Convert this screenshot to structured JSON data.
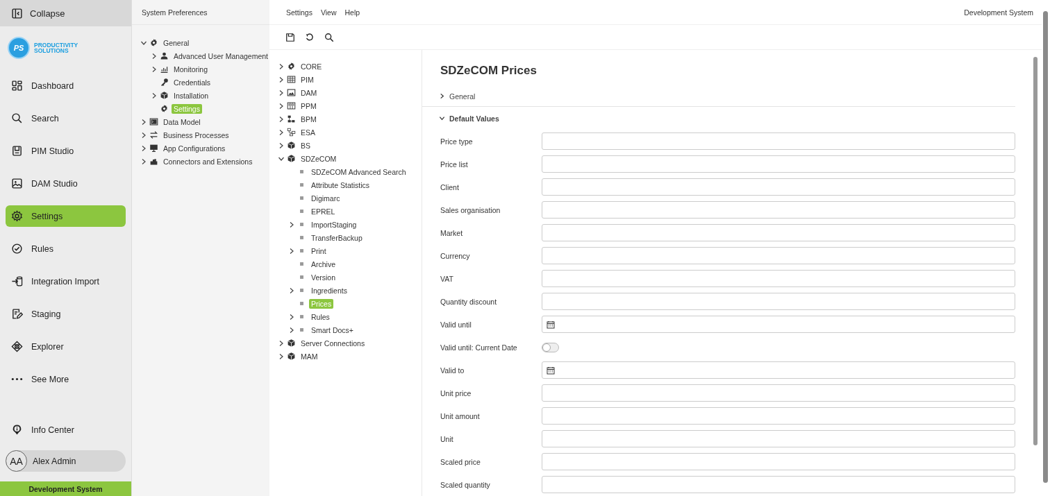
{
  "nav": {
    "collapse": "Collapse",
    "logo": {
      "initials": "PS",
      "line1": "PRODUCTIVITY",
      "line2": "SOLUTIONS"
    },
    "items": [
      {
        "label": "Dashboard",
        "selected": false
      },
      {
        "label": "Search",
        "selected": false
      },
      {
        "label": "PIM Studio",
        "selected": false
      },
      {
        "label": "DAM Studio",
        "selected": false
      },
      {
        "label": "Settings",
        "selected": true
      },
      {
        "label": "Rules",
        "selected": false
      },
      {
        "label": "Integration Import",
        "selected": false
      },
      {
        "label": "Staging",
        "selected": false
      },
      {
        "label": "Explorer",
        "selected": false
      },
      {
        "label": "See More",
        "selected": false
      }
    ],
    "info_center": "Info Center",
    "user": {
      "initials": "AA",
      "name": "Alex Admin"
    },
    "environment": "Development System"
  },
  "prefs": {
    "title": "System Preferences",
    "tree": [
      {
        "label": "General",
        "expanded": true,
        "selected": false,
        "children": [
          {
            "label": "Advanced User Management",
            "expanded": false,
            "selected": false
          },
          {
            "label": "Monitoring",
            "expanded": false,
            "selected": false
          },
          {
            "label": "Credentials",
            "selected": false
          },
          {
            "label": "Installation",
            "expanded": false,
            "selected": false
          },
          {
            "label": "Settings",
            "selected": true
          }
        ]
      },
      {
        "label": "Data Model",
        "expanded": false,
        "selected": false
      },
      {
        "label": "Business Processes",
        "expanded": false,
        "selected": false
      },
      {
        "label": "App Configurations",
        "expanded": false,
        "selected": false
      },
      {
        "label": "Connectors and Extensions",
        "expanded": false,
        "selected": false
      }
    ]
  },
  "menu": [
    "Settings",
    "View",
    "Help"
  ],
  "system_label": "Development System",
  "modules": [
    {
      "label": "CORE",
      "expanded": false,
      "selected": false
    },
    {
      "label": "PIM",
      "expanded": false,
      "selected": false
    },
    {
      "label": "DAM",
      "expanded": false,
      "selected": false
    },
    {
      "label": "PPM",
      "expanded": false,
      "selected": false
    },
    {
      "label": "BPM",
      "expanded": false,
      "selected": false
    },
    {
      "label": "ESA",
      "expanded": false,
      "selected": false
    },
    {
      "label": "BS",
      "expanded": false,
      "selected": false
    },
    {
      "label": "SDZeCOM",
      "expanded": true,
      "selected": false,
      "children": [
        {
          "label": "SDZeCOM Advanced Search",
          "selected": false
        },
        {
          "label": "Attribute Statistics",
          "selected": false
        },
        {
          "label": "Digimarc",
          "selected": false
        },
        {
          "label": "EPREL",
          "selected": false
        },
        {
          "label": "ImportStaging",
          "expanded": false,
          "selected": false
        },
        {
          "label": "TransferBackup",
          "selected": false
        },
        {
          "label": "Print",
          "expanded": false,
          "selected": false
        },
        {
          "label": "Archive",
          "selected": false
        },
        {
          "label": "Version",
          "selected": false
        },
        {
          "label": "Ingredients",
          "expanded": false,
          "selected": false
        },
        {
          "label": "Prices",
          "selected": true
        },
        {
          "label": "Rules",
          "expanded": false,
          "selected": false
        },
        {
          "label": "Smart Docs+",
          "expanded": false,
          "selected": false
        }
      ]
    },
    {
      "label": "Server Connections",
      "expanded": false,
      "selected": false
    },
    {
      "label": "MAM",
      "expanded": false,
      "selected": false
    }
  ],
  "page": {
    "title": "SDZeCOM Prices",
    "sections": [
      {
        "label": "General",
        "expanded": false
      },
      {
        "label": "Default Values",
        "expanded": true
      }
    ],
    "fields": [
      {
        "label": "Price type",
        "kind": "text"
      },
      {
        "label": "Price list",
        "kind": "text"
      },
      {
        "label": "Client",
        "kind": "text"
      },
      {
        "label": "Sales organisation",
        "kind": "text"
      },
      {
        "label": "Market",
        "kind": "text"
      },
      {
        "label": "Currency",
        "kind": "text"
      },
      {
        "label": "VAT",
        "kind": "text"
      },
      {
        "label": "Quantity discount",
        "kind": "text"
      },
      {
        "label": "Valid until",
        "kind": "date"
      },
      {
        "label": "Valid until: Current Date",
        "kind": "toggle",
        "on": false
      },
      {
        "label": "Valid to",
        "kind": "date"
      },
      {
        "label": "Unit price",
        "kind": "text"
      },
      {
        "label": "Unit amount",
        "kind": "text"
      },
      {
        "label": "Unit",
        "kind": "text"
      },
      {
        "label": "Scaled price",
        "kind": "text"
      },
      {
        "label": "Scaled quantity",
        "kind": "text"
      }
    ]
  }
}
